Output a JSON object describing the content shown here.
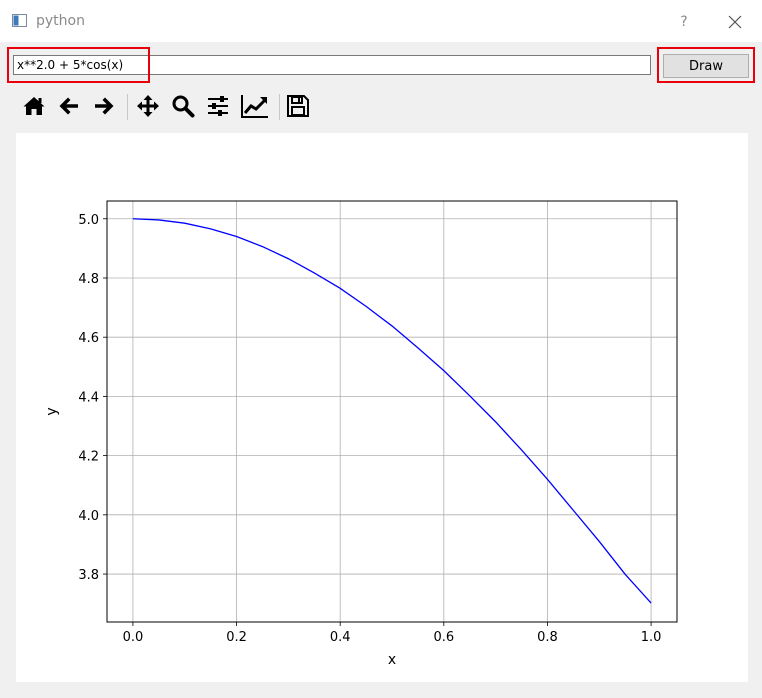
{
  "window": {
    "title": "python",
    "help_label": "?"
  },
  "controls": {
    "expression_value": "x**2.0 + 5*cos(x)",
    "draw_label": "Draw"
  },
  "toolbar": {
    "tools": [
      {
        "name": "home-icon"
      },
      {
        "name": "back-arrow-icon"
      },
      {
        "name": "forward-arrow-icon"
      },
      {
        "name": "pan-icon"
      },
      {
        "name": "zoom-icon"
      },
      {
        "name": "subplots-config-icon"
      },
      {
        "name": "edit-axes-icon"
      },
      {
        "name": "save-icon"
      }
    ]
  },
  "chart_data": {
    "type": "line",
    "xlabel": "x",
    "ylabel": "y",
    "xlim": [
      -0.05,
      1.05
    ],
    "ylim": [
      3.638,
      5.06
    ],
    "xticks": [
      0.0,
      0.2,
      0.4,
      0.6,
      0.8,
      1.0
    ],
    "xtick_labels": [
      "0.0",
      "0.2",
      "0.4",
      "0.6",
      "0.8",
      "1.0"
    ],
    "yticks": [
      3.8,
      4.0,
      4.2,
      4.4,
      4.6,
      4.8,
      5.0
    ],
    "ytick_labels": [
      "3.8",
      "4.0",
      "4.2",
      "4.4",
      "4.6",
      "4.8",
      "5.0"
    ],
    "grid": true,
    "series": [
      {
        "color": "#0000ff",
        "x": [
          0.0,
          0.05,
          0.1,
          0.15,
          0.2,
          0.25,
          0.3,
          0.35,
          0.4,
          0.45,
          0.5,
          0.55,
          0.6,
          0.65,
          0.7,
          0.75,
          0.8,
          0.85,
          0.9,
          0.95,
          1.0
        ],
        "y": [
          5.0,
          4.996,
          4.985,
          4.966,
          4.94,
          4.906,
          4.865,
          4.817,
          4.765,
          4.704,
          4.638,
          4.564,
          4.487,
          4.402,
          4.314,
          4.219,
          4.12,
          4.015,
          3.91,
          3.799,
          3.702
        ]
      }
    ]
  },
  "highlight_color": "#e8000b"
}
